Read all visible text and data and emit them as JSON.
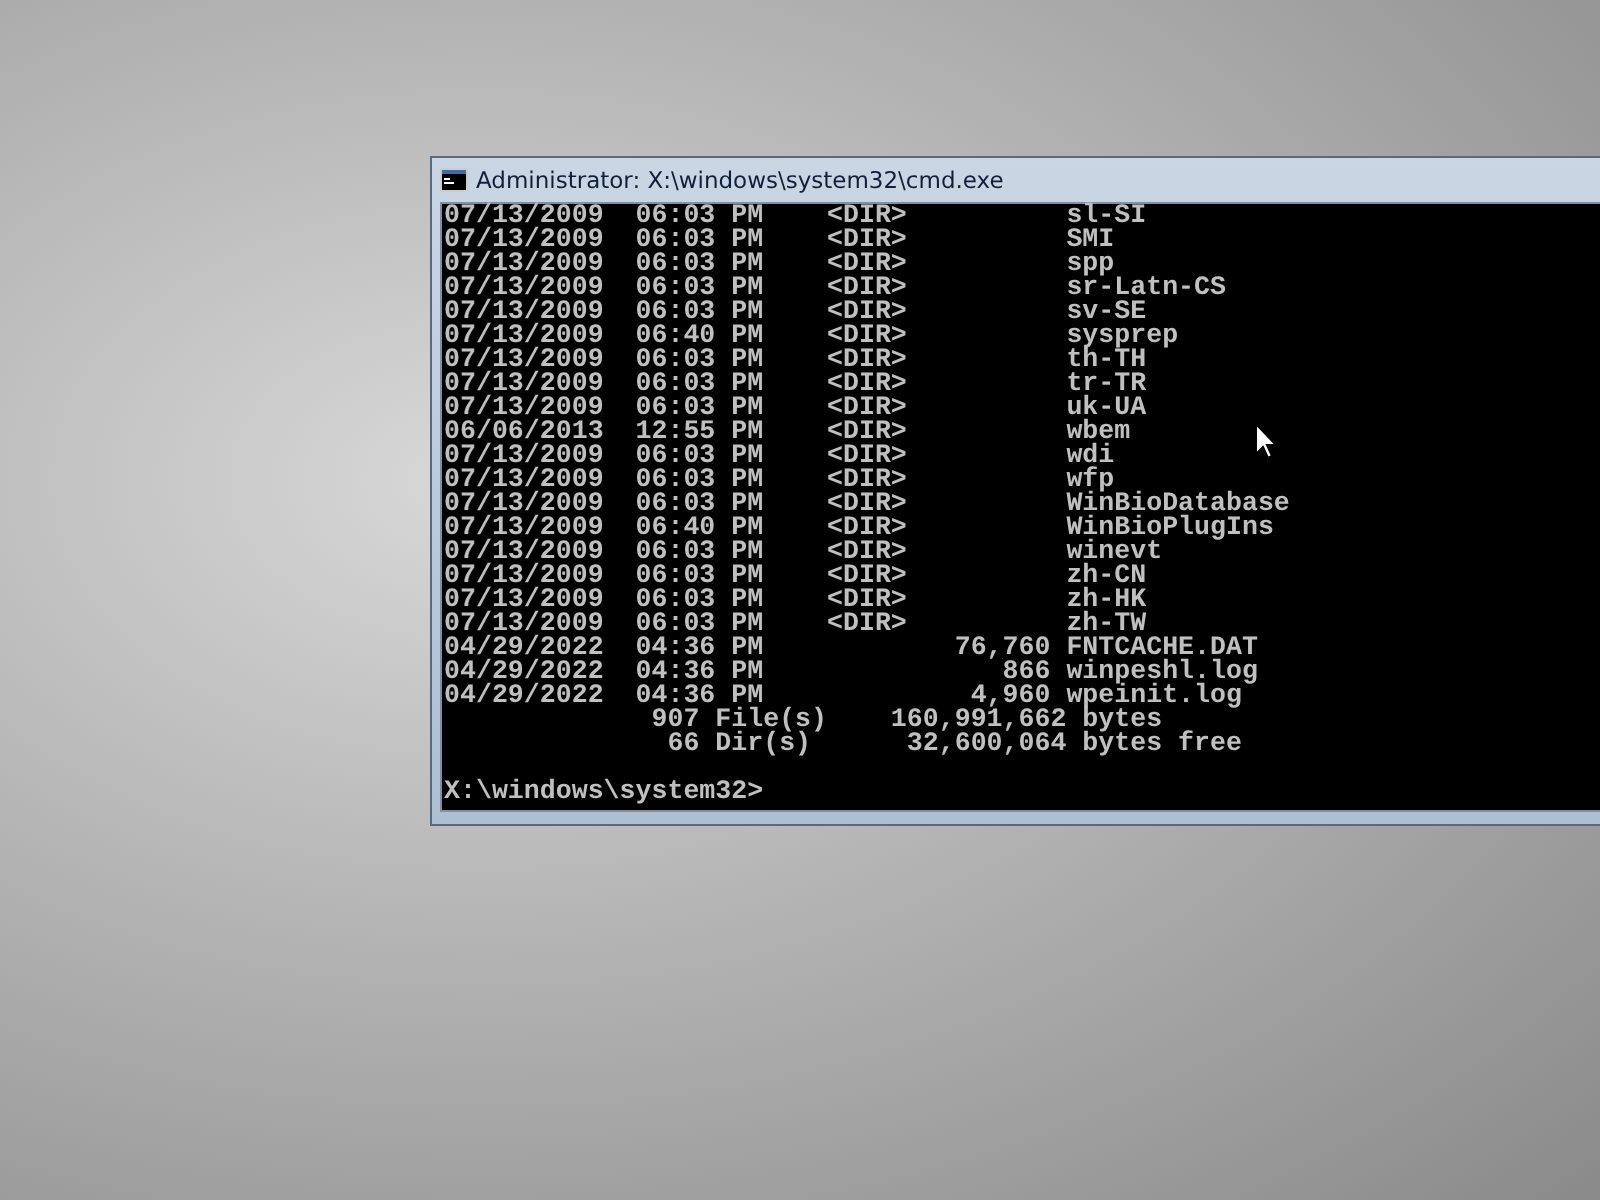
{
  "window": {
    "title": "Administrator: X:\\windows\\system32\\cmd.exe"
  },
  "console": {
    "lines": [
      "07/13/2009  06:03 PM    <DIR>          sl-SI",
      "07/13/2009  06:03 PM    <DIR>          SMI",
      "07/13/2009  06:03 PM    <DIR>          spp",
      "07/13/2009  06:03 PM    <DIR>          sr-Latn-CS",
      "07/13/2009  06:03 PM    <DIR>          sv-SE",
      "07/13/2009  06:40 PM    <DIR>          sysprep",
      "07/13/2009  06:03 PM    <DIR>          th-TH",
      "07/13/2009  06:03 PM    <DIR>          tr-TR",
      "07/13/2009  06:03 PM    <DIR>          uk-UA",
      "06/06/2013  12:55 PM    <DIR>          wbem",
      "07/13/2009  06:03 PM    <DIR>          wdi",
      "07/13/2009  06:03 PM    <DIR>          wfp",
      "07/13/2009  06:03 PM    <DIR>          WinBioDatabase",
      "07/13/2009  06:40 PM    <DIR>          WinBioPlugIns",
      "07/13/2009  06:03 PM    <DIR>          winevt",
      "07/13/2009  06:03 PM    <DIR>          zh-CN",
      "07/13/2009  06:03 PM    <DIR>          zh-HK",
      "07/13/2009  06:03 PM    <DIR>          zh-TW",
      "04/29/2022  04:36 PM            76,760 FNTCACHE.DAT",
      "04/29/2022  04:36 PM               866 winpeshl.log",
      "04/29/2022  04:36 PM             4,960 wpeinit.log",
      "             907 File(s)    160,991,662 bytes",
      "              66 Dir(s)      32,600,064 bytes free"
    ],
    "prompt": "X:\\windows\\system32>"
  }
}
